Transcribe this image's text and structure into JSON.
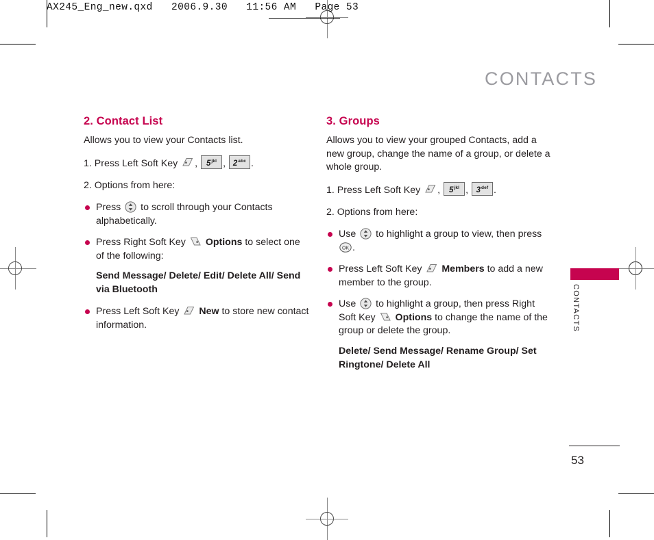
{
  "print_header": {
    "text": "AX245_Eng_new.qxd   2006.9.30   11:56 AM   Page 53"
  },
  "page_header": {
    "title": "CONTACTS"
  },
  "side_tab": {
    "label": "CONTACTS",
    "color": "#c6044f"
  },
  "footer": {
    "page_number": "53"
  },
  "colors": {
    "accent": "#c6044f",
    "header_gray": "#9b9ba0",
    "body": "#231f20"
  },
  "sections": {
    "left": {
      "title": "2. Contact List",
      "intro": "Allows you to view your Contacts list.",
      "step1_prefix": "1. Press Left Soft Key",
      "step1_key1": "5",
      "step1_key1_sub": "jkl",
      "step1_key2": "2",
      "step1_key2_sub": "abc",
      "step2": "2. Options from here:",
      "bullets": [
        {
          "pre": "Press",
          "icon": "nav-key",
          "post": "to scroll through your Contacts alphabetically."
        },
        {
          "pre": "Press Right Soft Key",
          "icon": "right-soft-key",
          "bold": "Options",
          "post": "to select one of the following:",
          "options": "Send Message/ Delete/ Edit/ Delete All/ Send via Bluetooth"
        },
        {
          "pre": "Press Left Soft Key",
          "icon": "left-soft-key",
          "bold": "New",
          "post": "to store new contact information."
        }
      ]
    },
    "right": {
      "title": "3. Groups",
      "intro": "Allows you to view your grouped Contacts, add a new group, change the name of a group, or delete a whole group.",
      "step1_prefix": "1. Press Left Soft Key",
      "step1_key1": "5",
      "step1_key1_sub": "jkl",
      "step1_key2": "3",
      "step1_key2_sub": "def",
      "step2": "2. Options from here:",
      "bullets": [
        {
          "pre": "Use",
          "icon": "nav-key",
          "post": "to highlight a group to view, then press",
          "icon2": "ok-key",
          "tail": "."
        },
        {
          "pre": "Press Left Soft Key",
          "icon": "left-soft-key",
          "bold": "Members",
          "post": "to add a  new member to the group."
        },
        {
          "pre": "Use",
          "icon": "nav-key",
          "post": "to highlight a group, then press Right Soft Key",
          "icon2": "right-soft-key",
          "bold": "Options",
          "tail": "to change the name of the group or delete the group.",
          "options": "Delete/ Send Message/ Rename Group/ Set Ringtone/ Delete All"
        }
      ]
    }
  }
}
